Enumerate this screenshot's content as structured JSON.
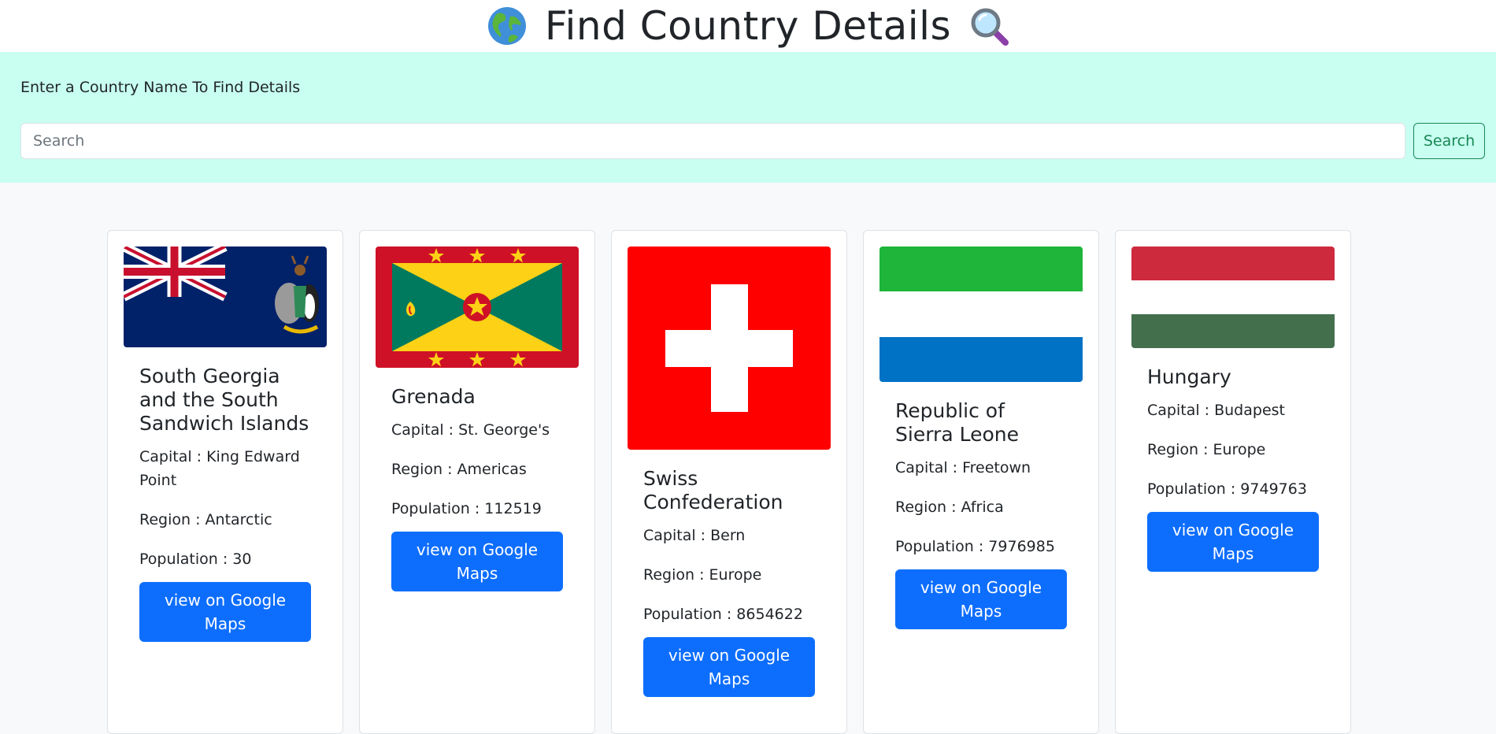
{
  "header": {
    "title": "Find Country Details",
    "left_icon": "globe-icon",
    "right_icon": "magnifier-icon"
  },
  "search": {
    "prompt": "Enter a Country Name To Find Details",
    "placeholder": "Search",
    "value": "",
    "button_label": "Search"
  },
  "colors": {
    "search_panel_bg": "#c8fff1",
    "button_primary": "#0d6efd",
    "button_outline": "#198754"
  },
  "countries": [
    {
      "name": "South Georgia and the South Sandwich Islands",
      "capital": "Capital : King Edward Point",
      "region": "Region : Antarctic",
      "population": "Population : 30",
      "button": "view on Google Maps",
      "flag_icon": "south-georgia-flag"
    },
    {
      "name": "Grenada",
      "capital": "Capital : St. George's",
      "region": "Region : Americas",
      "population": "Population : 112519",
      "button": "view on Google Maps",
      "flag_icon": "grenada-flag"
    },
    {
      "name": "Swiss Confederation",
      "capital": "Capital : Bern",
      "region": "Region : Europe",
      "population": "Population : 8654622",
      "button": "view on Google Maps",
      "flag_icon": "switzerland-flag"
    },
    {
      "name": "Republic of Sierra Leone",
      "capital": "Capital : Freetown",
      "region": "Region : Africa",
      "population": "Population : 7976985",
      "button": "view on Google Maps",
      "flag_icon": "sierra-leone-flag"
    },
    {
      "name": "Hungary",
      "capital": "Capital : Budapest",
      "region": "Region : Europe",
      "population": "Population : 9749763",
      "button": "view on Google Maps",
      "flag_icon": "hungary-flag"
    }
  ]
}
